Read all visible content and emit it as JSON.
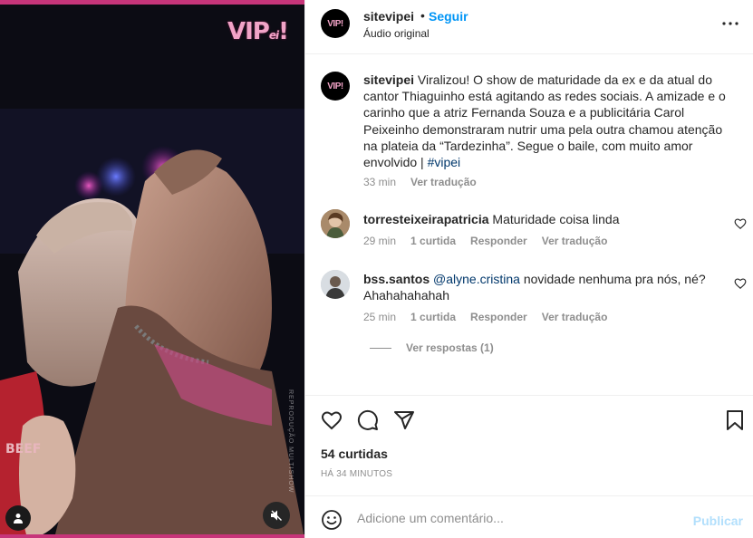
{
  "media": {
    "logo": "VIP",
    "logo_small": "ei",
    "logo_bang": "!",
    "watermark": "REPRODUÇÃO MULTISHOW",
    "icons": {
      "user_tag": "person-icon",
      "mute": "speaker-muted-icon"
    }
  },
  "header": {
    "username": "sitevipei",
    "dot": "•",
    "follow_label": "Seguir",
    "audio_label": "Áudio original",
    "avatar_text": "VIP!",
    "more_icon": "more-horizontal-icon"
  },
  "caption": {
    "username": "sitevipei",
    "text": "Viralizou! O show de maturidade da ex e da atual do cantor Thiaguinho está agitando as redes sociais. A amizade e o carinho que a atriz Fernanda Souza e a publicitária Carol Peixeinho demonstraram nutrir uma pela outra chamou atenção na plateia da “Tardezinha”. Segue o baile, com muito amor envolvido | ",
    "hashtag": "#vipei",
    "time": "33 min",
    "translate": "Ver tradução"
  },
  "comments": [
    {
      "username": "torresteixeirapatricia",
      "text": "Maturidade coisa linda",
      "time": "29 min",
      "likes": "1 curtida",
      "reply": "Responder",
      "translate": "Ver tradução"
    },
    {
      "username": "bss.santos",
      "mention": "@alyne.cristina",
      "text": " novidade nenhuma pra nós, né? Ahahahahahah",
      "time": "25 min",
      "likes": "1 curtida",
      "reply": "Responder",
      "translate": "Ver tradução"
    }
  ],
  "view_replies": "Ver respostas (1)",
  "actions": {
    "icons": [
      "heart-icon",
      "comment-icon",
      "share-icon",
      "bookmark-icon"
    ],
    "likes": "54 curtidas",
    "time_ago": "HÁ 34 MINUTOS"
  },
  "add_comment": {
    "placeholder": "Adicione um comentário...",
    "publish": "Publicar",
    "emoji_icon": "emoji-icon"
  },
  "colors": {
    "accent": "#0095f6",
    "link": "#00376b",
    "muted": "#8e8e8e",
    "publish_disabled": "#b2dffc",
    "frame": "#c7357a"
  }
}
